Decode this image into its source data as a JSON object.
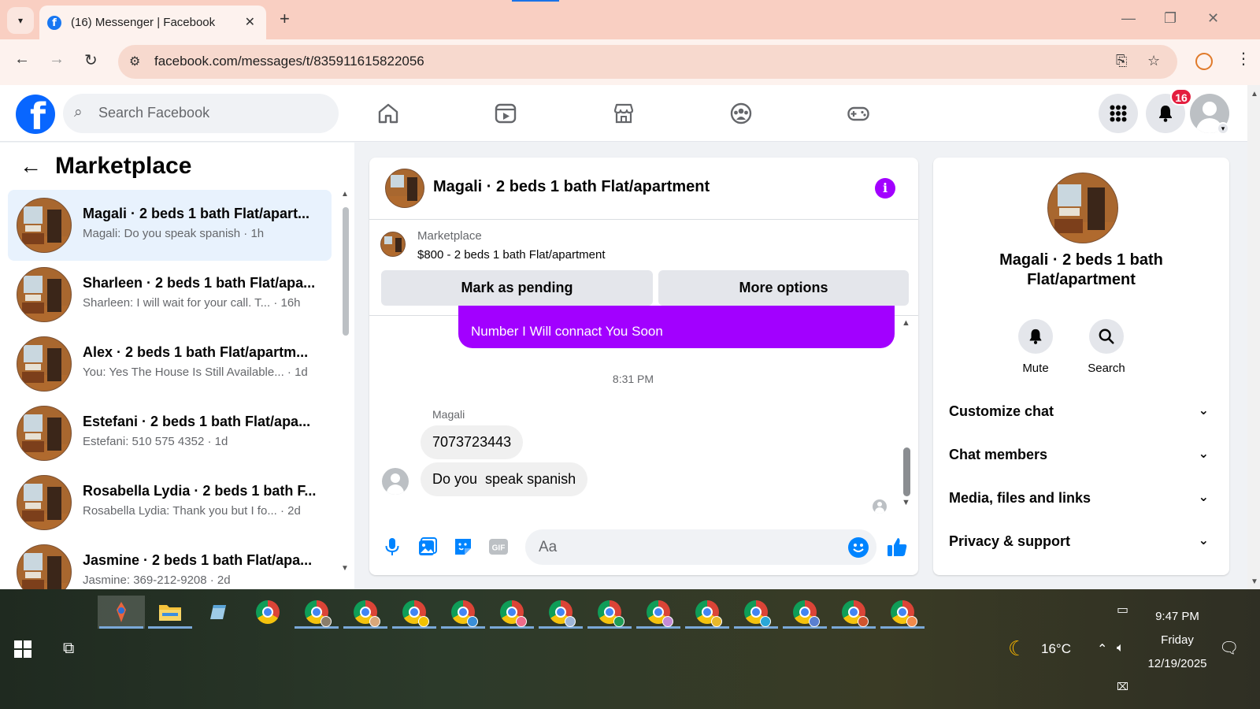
{
  "browser": {
    "tab_title": "(16) Messenger | Facebook",
    "url": "facebook.com/messages/t/835911615822056"
  },
  "fb": {
    "search_placeholder": "Search Facebook",
    "notification_count": "16"
  },
  "left": {
    "title": "Marketplace",
    "conversations": [
      {
        "name": "Magali · 2 beds 1 bath Flat/apart...",
        "preview": "Magali: Do you speak spanish · 1h",
        "active": true
      },
      {
        "name": "Sharleen · 2 beds 1 bath Flat/apa...",
        "preview": "Sharleen: I will wait for your call. T... · 16h",
        "active": false
      },
      {
        "name": "Alex · 2 beds 1 bath Flat/apartm...",
        "preview": "You: Yes The House Is Still Available... · 1d",
        "active": false
      },
      {
        "name": "Estefani · 2 beds 1 bath Flat/apa...",
        "preview": "Estefani: 510 575 4352 · 1d",
        "active": false
      },
      {
        "name": "Rosabella Lydia · 2 beds 1 bath F...",
        "preview": "Rosabella Lydia: Thank you but I fo... · 2d",
        "active": false
      },
      {
        "name": "Jasmine · 2 beds 1 bath Flat/apa...",
        "preview": "Jasmine: 369-212-9208 · 2d",
        "active": false
      }
    ]
  },
  "chat": {
    "title": "Magali · 2 beds 1 bath Flat/apartment",
    "marketplace_label": "Marketplace",
    "listing": "$800 - 2 beds 1 bath Flat/apartment",
    "mark_pending": "Mark as pending",
    "more_options": "More options",
    "outgoing_partial": "Number I Will connact You Soon",
    "time": "8:31 PM",
    "sender": "Magali",
    "messages": [
      "7073723443",
      "Do you  speak spanish"
    ],
    "composer_placeholder": "Aa"
  },
  "right": {
    "name": "Magali · 2 beds 1 bath Flat/apartment",
    "mute": "Mute",
    "search": "Search",
    "rows": [
      "Customize chat",
      "Chat members",
      "Media, files and links",
      "Privacy & support"
    ]
  },
  "taskbar": {
    "temperature": "16°C",
    "time": "9:47 PM",
    "day": "Friday",
    "date": "12/19/2025"
  },
  "colors": {
    "fb_blue": "#0866ff",
    "accent_purple": "#a200ff",
    "active_row": "#e8f2fd",
    "badge_red": "#e41e3f"
  }
}
